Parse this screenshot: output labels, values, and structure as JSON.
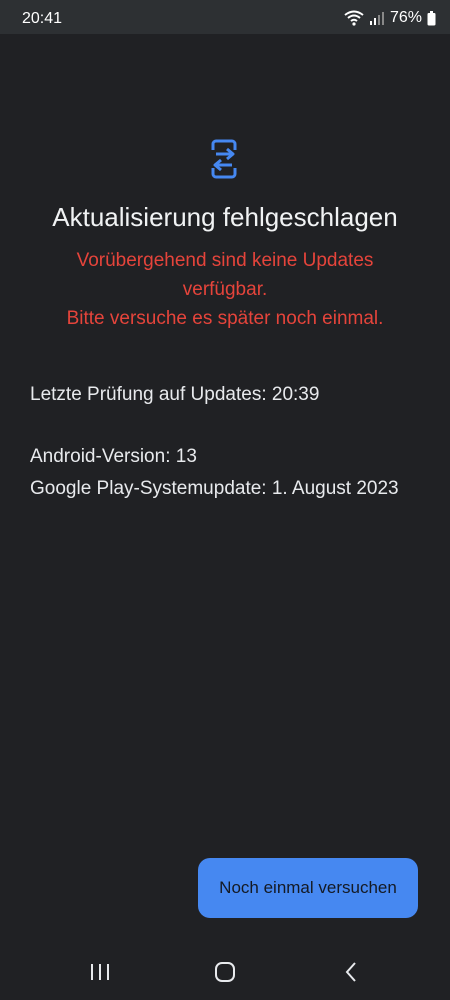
{
  "status_bar": {
    "time": "20:41",
    "battery": "76%",
    "icons": [
      "wifi-icon",
      "signal-icon",
      "battery-icon"
    ]
  },
  "main": {
    "icon": "system-update-icon",
    "title": "Aktualisierung fehlgeschlagen",
    "error_lines": [
      "Vorübergehend sind keine Updates",
      "verfügbar.",
      "Bitte versuche es später noch einmal."
    ],
    "last_check": "Letzte Prüfung auf Updates: 20:39",
    "android_version": "Android-Version: 13",
    "play_update": "Google Play-Systemupdate: 1. August 2023",
    "retry_label": "Noch einmal versuchen"
  },
  "nav_bar": {
    "icons": [
      "recent-apps-icon",
      "home-icon",
      "back-icon"
    ]
  },
  "colors": {
    "background": "#202124",
    "status_bar": "#2d3033",
    "error_text": "#e5443b",
    "accent": "#4688f1"
  }
}
